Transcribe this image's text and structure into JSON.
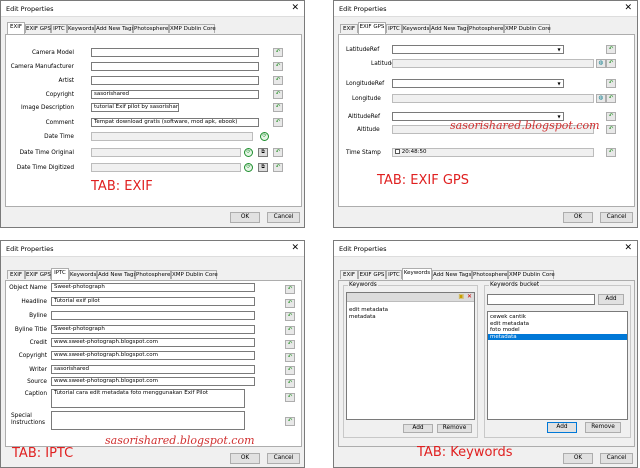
{
  "common": {
    "window_title": "Edit Properties",
    "close_glyph": "✕",
    "ok_label": "OK",
    "cancel_label": "Cancel",
    "tabs": [
      "EXIF",
      "EXIF GPS",
      "IPTC",
      "Keywords",
      "Add New Tags",
      "Photosphere",
      "XMP Dublin Core"
    ]
  },
  "exif": {
    "caption": "TAB: EXIF",
    "labels": [
      "Camera Model",
      "Camera Manufacturer",
      "Artist",
      "Copyright",
      "Image Description",
      "Comment",
      "Date Time",
      "Date Time Original",
      "Date Time Digitized"
    ],
    "values": [
      "",
      "",
      "",
      "sasorishared",
      "tutorial Exif pilot by sasorishared",
      "Tempat download gratis (software, mod apk, ebook)",
      "",
      "",
      ""
    ]
  },
  "gps": {
    "caption": "TAB: EXIF GPS",
    "watermark": "sasorishared.blogspot.com",
    "labels": [
      "LatitudeRef",
      "Latitude",
      "LongitudeRef",
      "Longitude",
      "AltitudeRef",
      "Altitude",
      "Time Stamp"
    ],
    "timestamp": "20:48:50"
  },
  "iptc": {
    "caption": "TAB: IPTC",
    "watermark": "sasorishared.blogspot.com",
    "labels": [
      "Object Name",
      "Headline",
      "Byline",
      "Byline Title",
      "Credit",
      "Copyright",
      "Writer",
      "Source",
      "Caption",
      "Special Instructions"
    ],
    "values": [
      "Sweet-photograph",
      "Tutorial exif pilot",
      "",
      "Sweet-photograph",
      "www.sweet-photograph.blogspot.com",
      "www.sweet-photograph.blogspot.com",
      "sasorishared",
      "www.sweet-photograph.blogspot.com",
      "Tutorial cara edit metadata foto menggunakan Exif Pilot",
      ""
    ]
  },
  "keywords": {
    "caption": "TAB: Keywords",
    "keywords_label": "Keywords",
    "bucket_label": "Keywords bucket",
    "keyword_items": [
      "edit metadata",
      "metadata"
    ],
    "bucket_items": [
      "cewek cantik",
      "edit metadata",
      "foto model",
      "metadata"
    ],
    "selected_index": 3,
    "add_label": "Add",
    "remove_label": "Remove"
  }
}
